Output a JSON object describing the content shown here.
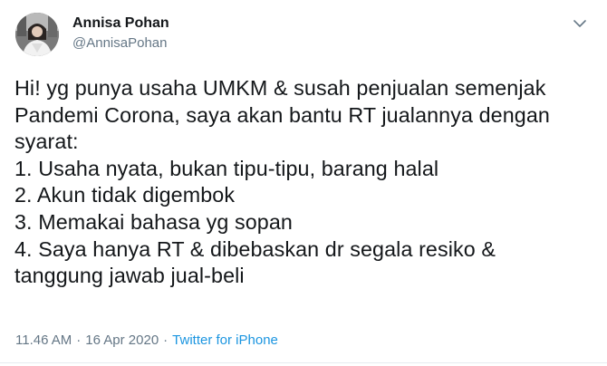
{
  "author": {
    "name": "Annisa Pohan",
    "handle": "@AnnisaPohan"
  },
  "tweet": {
    "lines": [
      "Hi! yg punya usaha UMKM & susah penjualan semenjak",
      "Pandemi Corona, saya akan bantu RT jualannya dengan",
      "syarat:",
      "1. Usaha nyata, bukan tipu-tipu, barang halal",
      "2. Akun tidak digembok",
      "3. Memakai bahasa yg sopan",
      "4. Saya hanya RT & dibebaskan dr segala resiko &",
      "tanggung jawab jual-beli"
    ],
    "time": "11.46 AM",
    "separator": "·",
    "date": "16 Apr 2020",
    "separator2": "·",
    "source": "Twitter for iPhone"
  },
  "icons": {
    "caret": "chevron-down-icon"
  },
  "colors": {
    "text": "#14171a",
    "muted": "#657786",
    "link": "#1b95e0"
  }
}
